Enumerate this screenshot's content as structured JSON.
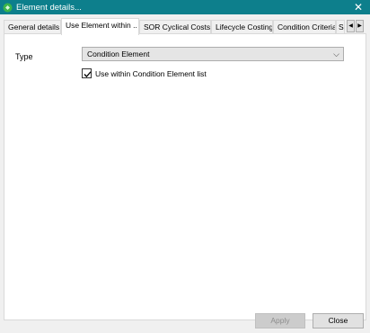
{
  "window": {
    "title": "Element details...",
    "close_glyph": "✕"
  },
  "tabs": [
    {
      "label": "General details"
    },
    {
      "label": "Use Element within .."
    },
    {
      "label": "SOR Cyclical Costs"
    },
    {
      "label": "Lifecycle Costing"
    },
    {
      "label": "Condition Criteria"
    },
    {
      "label": "S"
    }
  ],
  "tab_scroll": {
    "left": "◀",
    "right": "▶"
  },
  "form": {
    "type_label": "Type",
    "type_value": "Condition Element",
    "dropdown_glyph": "⌵",
    "checkbox_label": "Use within Condition Element list",
    "checkbox_checked": true
  },
  "buttons": {
    "apply": "Apply",
    "close": "Close"
  },
  "colors": {
    "titlebar": "#0d7f8c",
    "window_bg": "#f0f0f0",
    "panel_bg": "#ffffff"
  }
}
